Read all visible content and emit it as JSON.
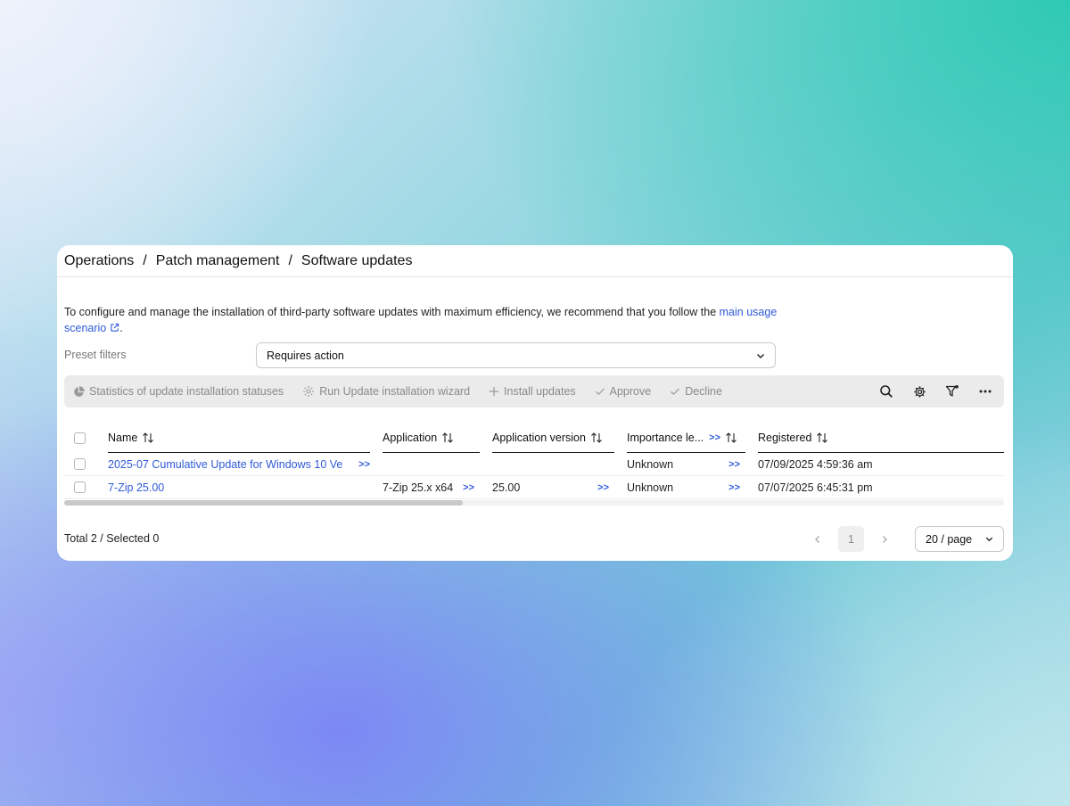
{
  "breadcrumb": [
    "Operations",
    "Patch management",
    "Software updates"
  ],
  "breadcrumb_separator": "/",
  "info": {
    "text": "To configure and manage the installation of third-party software updates with maximum efficiency, we recommend that you follow the ",
    "link": "main usage scenario",
    "suffix": "."
  },
  "preset_filters": {
    "label": "Preset filters",
    "value": "Requires action"
  },
  "toolbar": {
    "statistics": "Statistics of update installation statuses",
    "wizard": "Run Update installation wizard",
    "install": "Install updates",
    "approve": "Approve",
    "decline": "Decline",
    "icons": [
      "search-icon",
      "gear-icon",
      "filter-icon",
      "more-icon"
    ]
  },
  "table": {
    "columns": {
      "name": "Name",
      "application": "Application",
      "version": "Application version",
      "importance": "Importance le...",
      "registered": "Registered"
    },
    "more_glyph": ">>",
    "rows": [
      {
        "name": "2025-07 Cumulative Update for Windows 10 Ve",
        "application": "",
        "version": "",
        "importance": "Unknown",
        "registered": "07/09/2025 4:59:36 am"
      },
      {
        "name": "7-Zip 25.00",
        "application": "7-Zip 25.x x64",
        "version": "25.00",
        "importance": "Unknown",
        "registered": "07/07/2025 6:45:31 pm"
      }
    ]
  },
  "footer": {
    "total": "Total 2 / Selected 0",
    "current_page": "1",
    "page_size": "20 / page"
  },
  "colors": {
    "accent": "#2f5ad8",
    "toolbar_bg": "#ebebec"
  }
}
